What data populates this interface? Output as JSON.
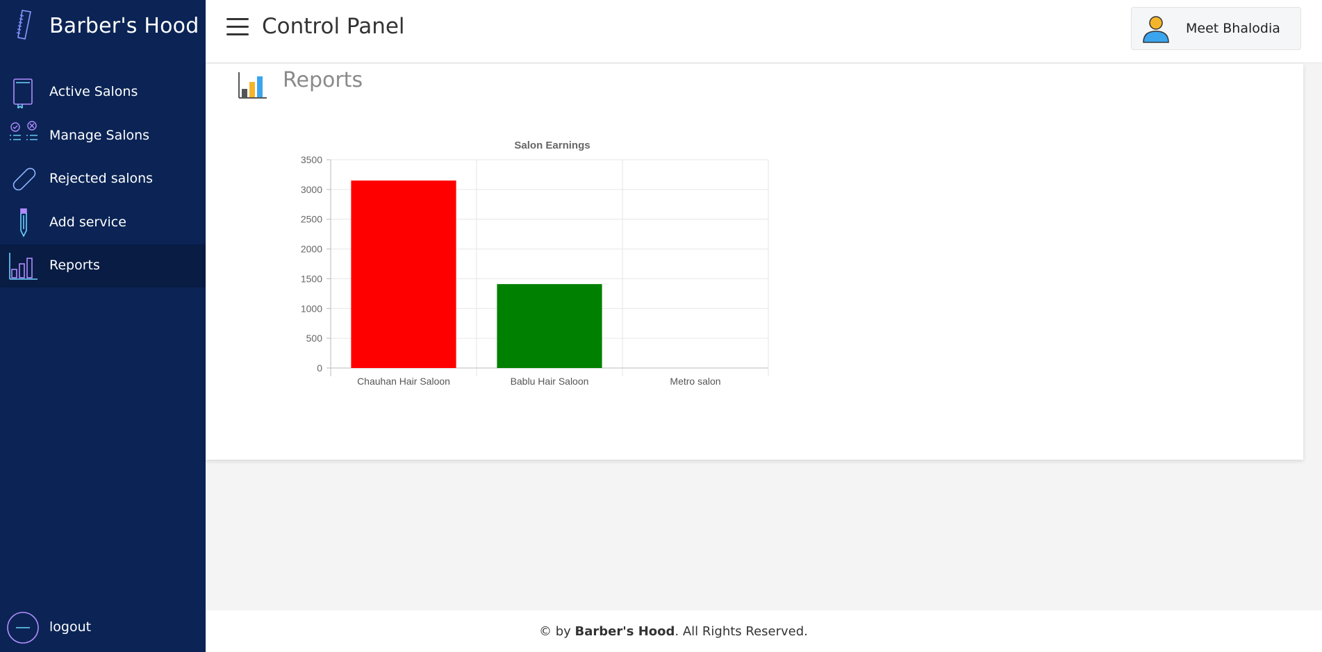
{
  "brand": {
    "name": "Barber's Hood"
  },
  "sidebar": {
    "items": [
      {
        "label": "Active Salons",
        "icon": "book-icon"
      },
      {
        "label": "Manage Salons",
        "icon": "checklist-icon"
      },
      {
        "label": "Rejected salons",
        "icon": "pill-icon"
      },
      {
        "label": "Add service",
        "icon": "pencil-icon"
      },
      {
        "label": "Reports",
        "icon": "bar-chart-icon",
        "active": true
      }
    ],
    "logout_label": "logout"
  },
  "header": {
    "title": "Control Panel",
    "user_name": "Meet Bhalodia"
  },
  "main": {
    "section_title": "Reports"
  },
  "footer": {
    "prefix": "© by ",
    "brand": "Barber's Hood",
    "suffix": ". All Rights Reserved."
  },
  "colors": {
    "sidebar_bg": "#0b2455",
    "active_bg": "#081c44",
    "bar_1": "#ff0000",
    "bar_2": "#008000"
  },
  "chart_data": {
    "type": "bar",
    "title": "Salon Earnings",
    "categories": [
      "Chauhan Hair Saloon",
      "Bablu Hair Saloon",
      "Metro salon"
    ],
    "values": [
      3150,
      1410,
      0
    ],
    "bar_colors": [
      "#ff0000",
      "#008000",
      "#cccccc"
    ],
    "yticks": [
      0,
      500,
      1000,
      1500,
      2000,
      2500,
      3000,
      3500
    ],
    "ylim": [
      0,
      3500
    ],
    "grid": true,
    "xlabel": "",
    "ylabel": ""
  }
}
